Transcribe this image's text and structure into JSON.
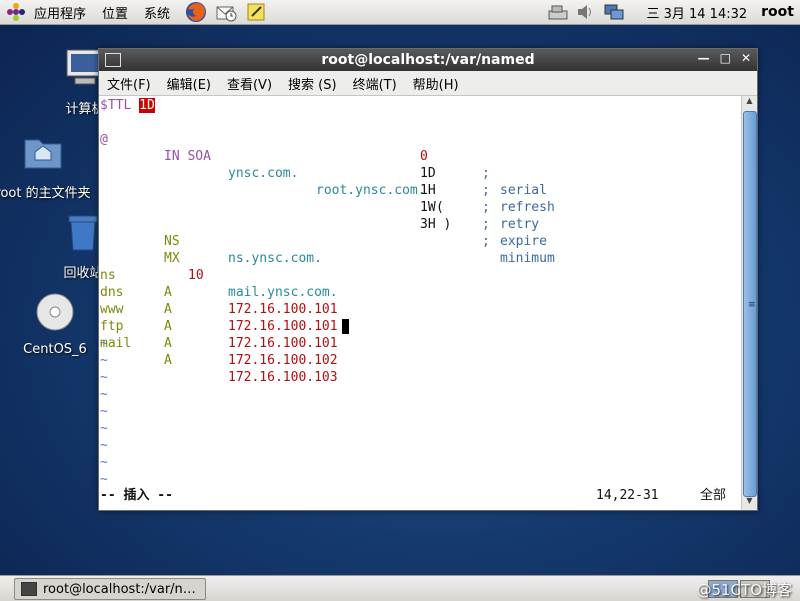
{
  "top_panel": {
    "menus": [
      "应用程序",
      "位置",
      "系统"
    ],
    "clock": "三 3月 14 14:32",
    "user": "root"
  },
  "desktop": {
    "icons": [
      "计算机",
      "root 的主文件夹",
      "回收站",
      "CentOS_6"
    ]
  },
  "window": {
    "title": "root@localhost:/var/named",
    "menus": [
      "文件(F)",
      "编辑(E)",
      "查看(V)",
      "搜索 (S)",
      "终端(T)",
      "帮助(H)"
    ]
  },
  "terminal": {
    "ttl_label": "$TTL ",
    "ttl_value": "1D",
    "soa": {
      "at": "@",
      "class_type": "IN SOA",
      "ns": "ynsc.com.",
      "mail": "root.ynsc.com.",
      "paren": "("
    },
    "soa_fields": [
      {
        "value": "0",
        "name": "serial"
      },
      {
        "value": "1D",
        "name": "refresh"
      },
      {
        "value": "1H",
        "name": "retry"
      },
      {
        "value": "1W",
        "name": "expire"
      },
      {
        "value": "3H )",
        "name": "minimum"
      }
    ],
    "ns_record": {
      "type": "NS",
      "target": "ns.ynsc.com."
    },
    "mx_record": {
      "type": "MX",
      "priority": "10",
      "target": "mail.ynsc.com."
    },
    "a_records": [
      {
        "name": "ns",
        "type": "A",
        "ip": "172.16.100.101"
      },
      {
        "name": "dns",
        "type": "A",
        "ip": "172.16.100.101"
      },
      {
        "name": "www",
        "type": "A",
        "ip": "172.16.100.101"
      },
      {
        "name": "ftp",
        "type": "A",
        "ip": "172.16.100.102"
      },
      {
        "name": "mail",
        "type": "A",
        "ip": "172.16.100.103"
      }
    ],
    "tilde": "~",
    "status_mode": "-- 插入 --",
    "status_pos": "14,22-31",
    "status_scroll": "全部"
  },
  "taskbar": {
    "task_label": "root@localhost:/var/n…",
    "watermark": "@51CTO博客"
  }
}
